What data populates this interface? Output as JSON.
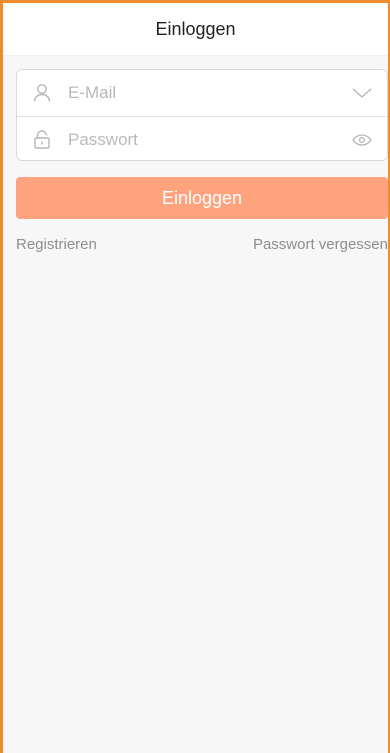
{
  "header": {
    "title": "Einloggen"
  },
  "form": {
    "email": {
      "placeholder": "E-Mail",
      "value": ""
    },
    "password": {
      "placeholder": "Passwort",
      "value": ""
    }
  },
  "actions": {
    "login_label": "Einloggen"
  },
  "links": {
    "register": "Registrieren",
    "forgot_password": "Passwort vergessen"
  },
  "icons": {
    "email_leading": "user-icon",
    "email_trailing": "chevron-down-icon",
    "password_leading": "lock-icon",
    "password_trailing": "eye-icon"
  },
  "colors": {
    "accent": "#ffa37f",
    "frame_border": "#ef8d2e",
    "page_background": "#f7f7f7",
    "link_text": "#8e8e8e"
  }
}
